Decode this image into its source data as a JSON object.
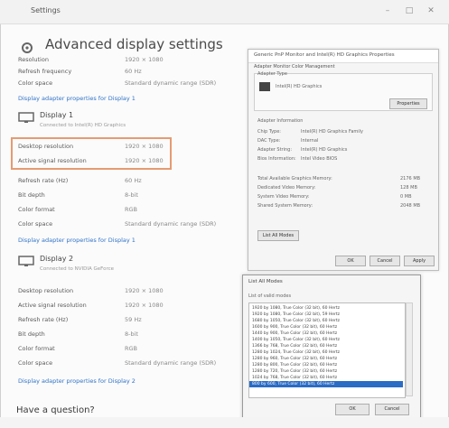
{
  "window": {
    "back_label": "Settings",
    "min_glyph": "–",
    "max_glyph": "□",
    "close_glyph": "✕"
  },
  "page": {
    "title": "Advanced display settings"
  },
  "display1": {
    "rows_top": [
      {
        "label": "Resolution",
        "value": "1920 × 1080"
      },
      {
        "label": "Refresh frequency",
        "value": "60 Hz"
      },
      {
        "label": "Color space",
        "value": "Standard dynamic range (SDR)"
      }
    ],
    "link_top": "Display adapter properties for Display 1",
    "title": "Display 1",
    "subtitle": "Connected to Intel(R) HD Graphics",
    "highlighted": [
      {
        "label": "Desktop resolution",
        "value": "1920 × 1080"
      },
      {
        "label": "Active signal resolution",
        "value": "1920 × 1080"
      }
    ],
    "rows": [
      {
        "label": "Refresh rate (Hz)",
        "value": "60 Hz"
      },
      {
        "label": "Bit depth",
        "value": "8-bit"
      },
      {
        "label": "Color format",
        "value": "RGB"
      },
      {
        "label": "Color space",
        "value": "Standard dynamic range (SDR)"
      }
    ],
    "link": "Display adapter properties for Display 1"
  },
  "display2": {
    "title": "Display 2",
    "subtitle": "Connected to NVIDIA GeForce",
    "rows": [
      {
        "label": "Desktop resolution",
        "value": "1920 × 1080"
      },
      {
        "label": "Active signal resolution",
        "value": "1920 × 1080"
      },
      {
        "label": "Refresh rate (Hz)",
        "value": "59 Hz"
      },
      {
        "label": "Bit depth",
        "value": "8-bit"
      },
      {
        "label": "Color format",
        "value": "RGB"
      },
      {
        "label": "Color space",
        "value": "Standard dynamic range (SDR)"
      }
    ],
    "link": "Display adapter properties for Display 2"
  },
  "question": "Have a question?",
  "adapter_dialog": {
    "title": "Generic PnP Monitor and Intel(R) HD Graphics Properties",
    "tabs": "Adapter   Monitor   Color Management",
    "adapter_type_label": "Adapter Type",
    "adapter_name": "Intel(R) HD Graphics",
    "properties_button": "Properties",
    "info_label": "Adapter Information",
    "info_rows": [
      {
        "k": "Chip Type:",
        "v": "Intel(R) HD Graphics Family"
      },
      {
        "k": "DAC Type:",
        "v": "Internal"
      },
      {
        "k": "Adapter String:",
        "v": "Intel(R) HD Graphics"
      },
      {
        "k": "Bios Information:",
        "v": "Intel Video BIOS"
      }
    ],
    "mem_rows": [
      {
        "k": "Total Available Graphics Memory:",
        "v": "2176 MB"
      },
      {
        "k": "Dedicated Video Memory:",
        "v": "128 MB"
      },
      {
        "k": "System Video Memory:",
        "v": "0 MB"
      },
      {
        "k": "Shared System Memory:",
        "v": "2048 MB"
      }
    ],
    "list_modes_button": "List All Modes",
    "ok": "OK",
    "cancel": "Cancel",
    "apply": "Apply"
  },
  "modes_dialog": {
    "title": "List All Modes",
    "list_label": "List of valid modes",
    "modes": [
      "1920 by 1080, True Color (32 bit), 60 Hertz",
      "1920 by 1080, True Color (32 bit), 59 Hertz",
      "1680 by 1050, True Color (32 bit), 60 Hertz",
      "1600 by 900, True Color (32 bit), 60 Hertz",
      "1440 by 900, True Color (32 bit), 60 Hertz",
      "1400 by 1050, True Color (32 bit), 60 Hertz",
      "1366 by 768, True Color (32 bit), 60 Hertz",
      "1280 by 1024, True Color (32 bit), 60 Hertz",
      "1280 by 960, True Color (32 bit), 60 Hertz",
      "1280 by 800, True Color (32 bit), 60 Hertz",
      "1280 by 720, True Color (32 bit), 60 Hertz",
      "1024 by 768, True Color (32 bit), 60 Hertz",
      "800 by 600, True Color (32 bit), 60 Hertz"
    ],
    "selected_index": 12,
    "ok": "OK",
    "cancel": "Cancel"
  }
}
